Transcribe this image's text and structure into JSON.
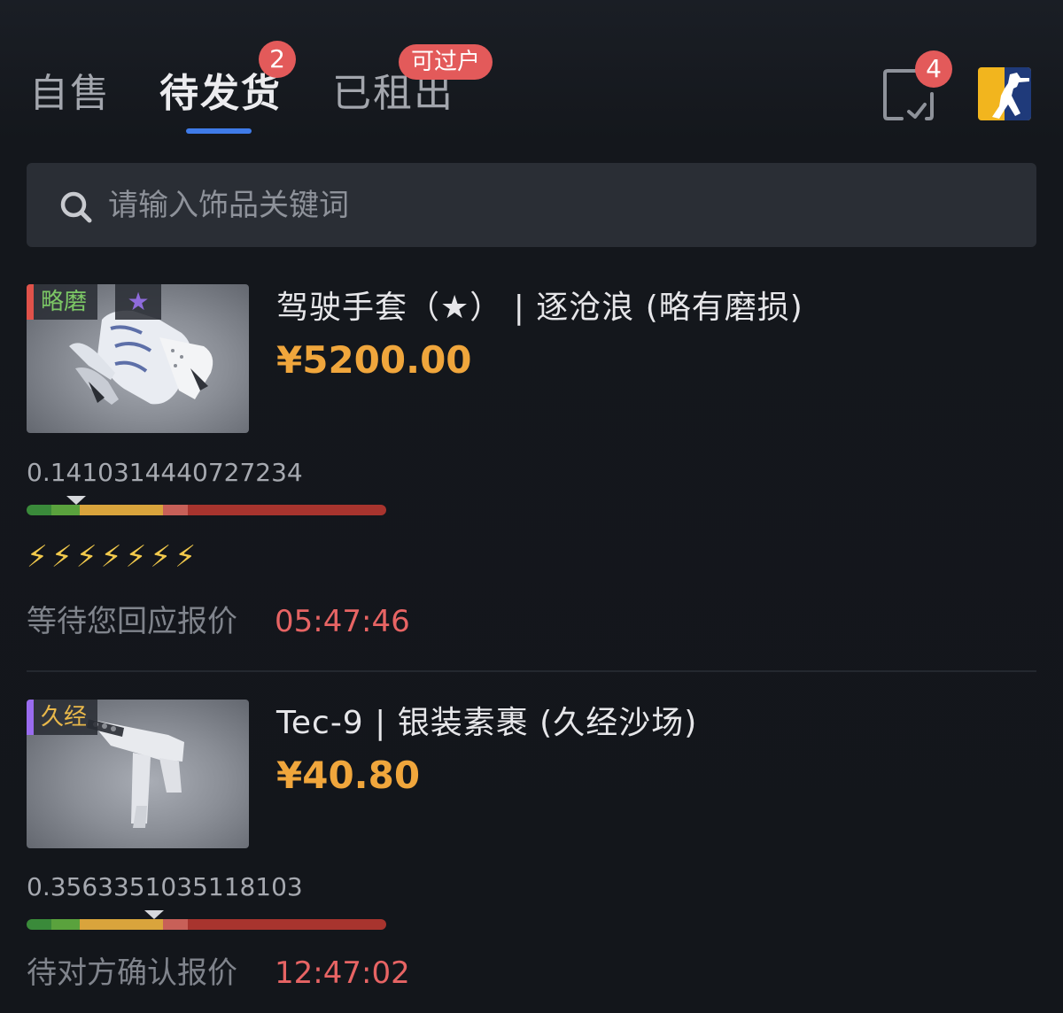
{
  "tabs": [
    {
      "label": "自售"
    },
    {
      "label": "待发货",
      "badge": "2"
    },
    {
      "label": "已租出",
      "badge": "可过户"
    }
  ],
  "header": {
    "check_icon": "checklist-icon",
    "check_badge": "4",
    "logo_icon": "counter-strike-logo"
  },
  "search": {
    "placeholder": "请输入饰品关键词",
    "icon": "search-icon"
  },
  "items": [
    {
      "wear_tag": "略磨",
      "star_icon": "★",
      "name": "驾驶手套（★） | 逐沧浪 (略有磨损)",
      "price": "¥5200.00",
      "float": "0.1410314440727234",
      "float_value": 0.1410314440727234,
      "bolts": "⚡⚡⚡⚡⚡⚡⚡",
      "status": "等待您回应报价",
      "timer": "05:47:46"
    },
    {
      "wear_tag": "久经",
      "name": "Tec-9 | 银装素裹 (久经沙场)",
      "price": "¥40.80",
      "float": "0.3563351035118103",
      "float_value": 0.3563351035118103,
      "status": "待对方确认报价",
      "timer": "12:47:02"
    }
  ],
  "colors": {
    "accent": "#3f7be8",
    "badge": "#e35a5a",
    "price": "#f0a63c",
    "timer": "#e76464",
    "wear_fn": "#3a8a3a",
    "wear_mw": "#5aa23d",
    "wear_ft": "#d9a43c",
    "wear_ww": "#c86058",
    "wear_bs": "#a8342e"
  }
}
